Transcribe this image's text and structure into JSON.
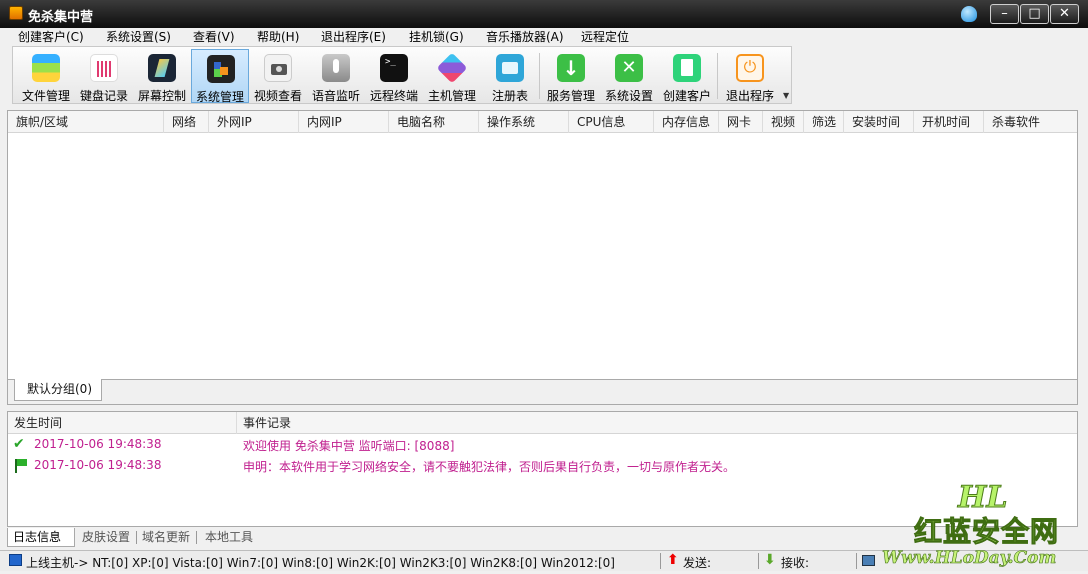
{
  "window": {
    "title": "免杀集中营"
  },
  "menu": [
    "创建客户(C)",
    "系统设置(S)",
    "查看(V)",
    "帮助(H)",
    "退出程序(E)",
    "挂机锁(G)",
    "音乐播放器(A)",
    "远程定位"
  ],
  "toolbar": [
    {
      "label": "文件管理",
      "icon": "folder-icon"
    },
    {
      "label": "键盘记录",
      "icon": "keyboard-icon"
    },
    {
      "label": "屏幕控制",
      "icon": "screen-icon"
    },
    {
      "label": "系统管理",
      "icon": "system-icon",
      "active": true
    },
    {
      "label": "视频查看",
      "icon": "camera-icon"
    },
    {
      "label": "语音监听",
      "icon": "microphone-icon"
    },
    {
      "label": "远程终端",
      "icon": "terminal-icon"
    },
    {
      "label": "主机管理",
      "icon": "host-icon"
    },
    {
      "label": "注册表",
      "icon": "registry-icon"
    },
    {
      "label": "服务管理",
      "icon": "service-icon"
    },
    {
      "label": "系统设置",
      "icon": "settings-icon"
    },
    {
      "label": "创建客户",
      "icon": "new-client-icon"
    },
    {
      "label": "退出程序",
      "icon": "power-icon"
    }
  ],
  "host_table": {
    "columns": [
      "旗帜/区域",
      "网络",
      "外网IP",
      "内网IP",
      "电脑名称",
      "操作系统",
      "CPU信息",
      "内存信息",
      "网卡",
      "视频",
      "筛选",
      "安装时间",
      "开机时间",
      "杀毒软件"
    ],
    "rows": []
  },
  "group_tab": "默认分组(0)",
  "log": {
    "columns": [
      "发生时间",
      "事件记录"
    ],
    "rows": [
      {
        "time": "2017-10-06 19:48:38",
        "message": "欢迎使用 免杀集中营   监听端口: [8088]",
        "icon": "check-icon"
      },
      {
        "time": "2017-10-06 19:48:38",
        "message": "申明：本软件用于学习网络安全，请不要触犯法律，否则后果自行负责，一切与原作者无关。",
        "icon": "flag-icon"
      }
    ]
  },
  "bottom_tabs": [
    "日志信息",
    "皮肤设置",
    "域名更新",
    "本地工具"
  ],
  "status": {
    "online": "上线主机-> NT:[0] XP:[0] Vista:[0] Win7:[0] Win8:[0] Win2K:[0] Win2K3:[0] Win2K8:[0] Win2012:[0]",
    "send": "发送:",
    "recv": "接收:"
  },
  "watermark": {
    "line1": "HL",
    "line2": "红蓝安全网",
    "line3": "Www.HLoDay.Com"
  },
  "colors": {
    "log_text": "#c0208f",
    "title_bg": "#0d0d0d",
    "active_tool": "#b0d6f5"
  }
}
